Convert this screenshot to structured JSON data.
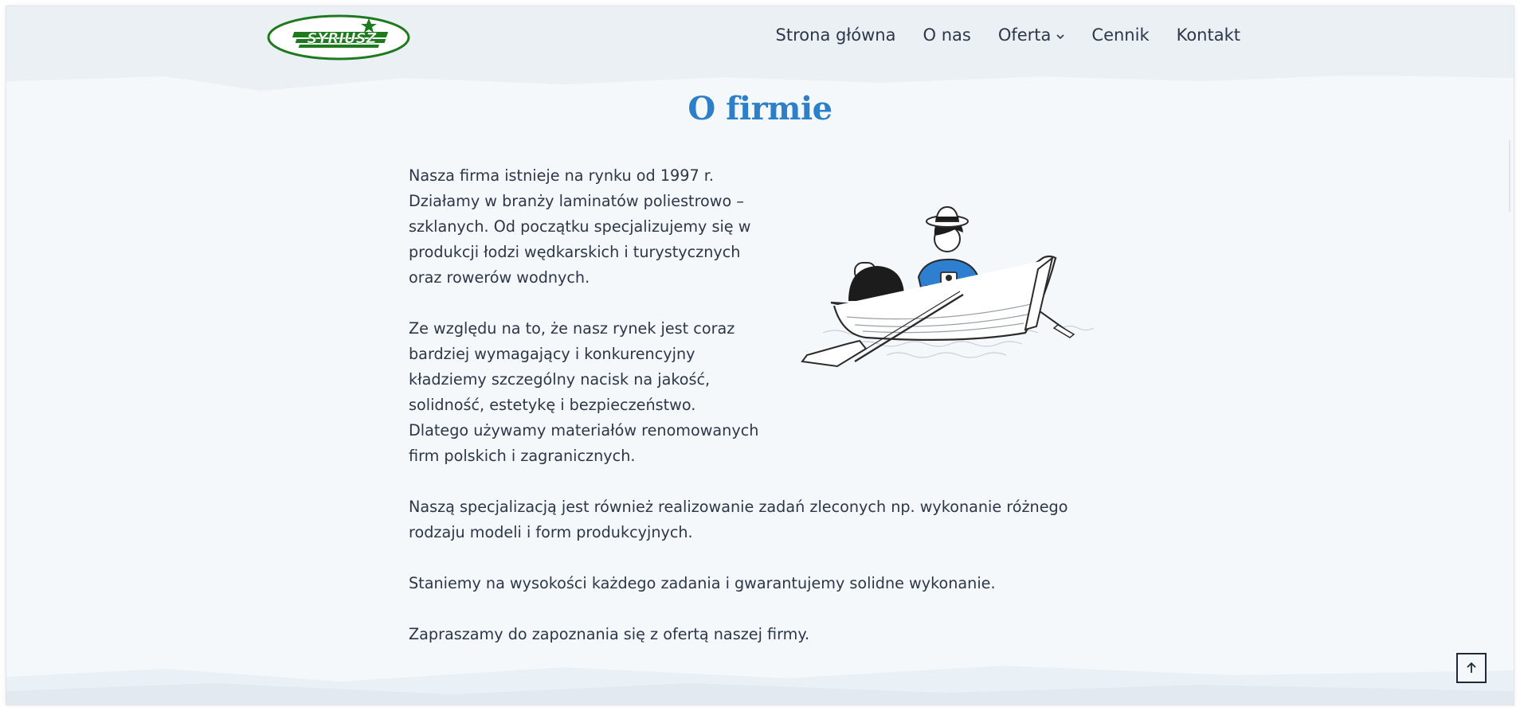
{
  "header": {
    "logo_text": "SYRIUSZ",
    "nav": [
      {
        "label": "Strona główna"
      },
      {
        "label": "O nas"
      },
      {
        "label": "Oferta",
        "has_dropdown": true
      },
      {
        "label": "Cennik"
      },
      {
        "label": "Kontakt"
      }
    ]
  },
  "main": {
    "title": "O firmie",
    "paragraphs_left": [
      "Nasza firma istnieje na rynku od 1997 r. Działamy w branży laminatów poliestrowo – szklanych. Od początku specjalizujemy się w produkcji łodzi wędkarskich i turystycznych oraz rowerów wodnych.",
      "Ze względu na to, że nasz rynek jest coraz bardziej wymagający i konkurencyjny kładziemy szczególny nacisk na jakość, solidność, estetykę i bezpieczeństwo. Dlatego używamy materiałów renomowanych firm polskich i zagranicznych."
    ],
    "paragraphs_wide": [
      "Naszą specjalizacją jest również realizowanie zadań zleconych np. wykonanie różnego rodzaju modeli i form produkcyjnych.",
      "Staniemy na wysokości każdego zadania i gwarantujemy solidne wykonanie.",
      "Zapraszamy do zapoznania się z ofertą naszej firmy."
    ]
  },
  "icons": {
    "scroll_top": "arrow-up-icon",
    "dropdown": "chevron-down-icon"
  },
  "colors": {
    "brand_green": "#1f7a1f",
    "title_blue": "#2d80c7",
    "text": "#2d3748",
    "shirt_blue": "#2f7fd1",
    "background": "#f4f8fb",
    "header_bg": "#ebf0f4"
  }
}
